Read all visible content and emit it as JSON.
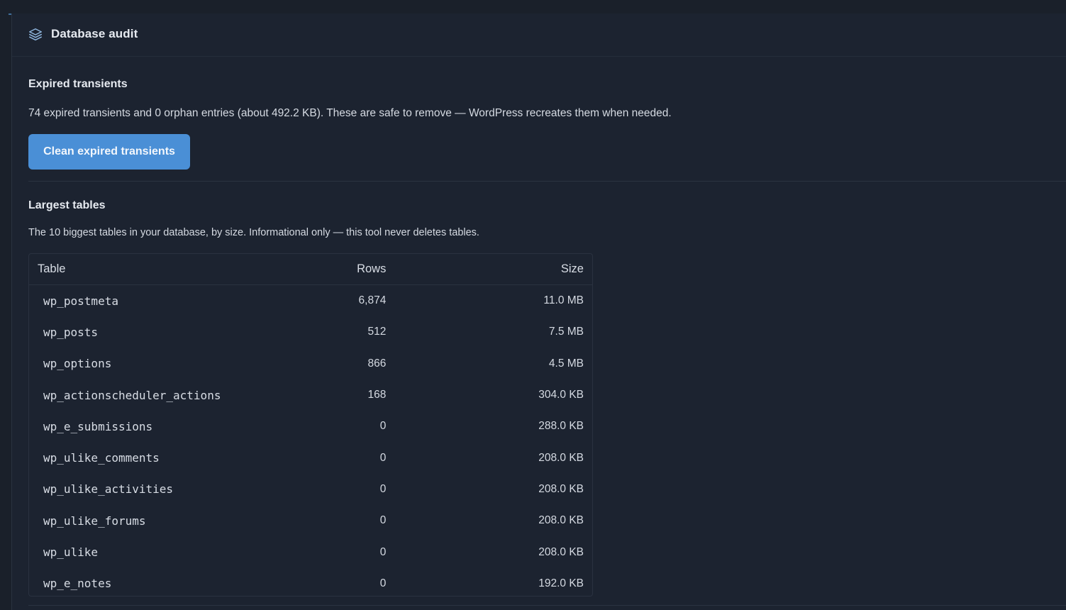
{
  "header": {
    "title": "Database audit",
    "icon": "layers-icon"
  },
  "transients": {
    "title": "Expired transients",
    "description": "74 expired transients and 0 orphan entries (about 492.2 KB). These are safe to remove — WordPress recreates them when needed.",
    "button_label": "Clean expired transients"
  },
  "largest_tables": {
    "title": "Largest tables",
    "description": "The 10 biggest tables in your database, by size. Informational only — this tool never deletes tables.",
    "columns": [
      "Table",
      "Rows",
      "Size"
    ],
    "rows": [
      {
        "table": "wp_postmeta",
        "rows": "6,874",
        "size": "11.0 MB"
      },
      {
        "table": "wp_posts",
        "rows": "512",
        "size": "7.5 MB"
      },
      {
        "table": "wp_options",
        "rows": "866",
        "size": "4.5 MB"
      },
      {
        "table": "wp_actionscheduler_actions",
        "rows": "168",
        "size": "304.0 KB"
      },
      {
        "table": "wp_e_submissions",
        "rows": "0",
        "size": "288.0 KB"
      },
      {
        "table": "wp_ulike_comments",
        "rows": "0",
        "size": "208.0 KB"
      },
      {
        "table": "wp_ulike_activities",
        "rows": "0",
        "size": "208.0 KB"
      },
      {
        "table": "wp_ulike_forums",
        "rows": "0",
        "size": "208.0 KB"
      },
      {
        "table": "wp_ulike",
        "rows": "0",
        "size": "208.0 KB"
      },
      {
        "table": "wp_e_notes",
        "rows": "0",
        "size": "192.0 KB"
      }
    ]
  },
  "colors": {
    "background": "#1a202a",
    "panel": "#1c2330",
    "accent": "#4a8fd6",
    "accent_line": "#3f6f9c"
  }
}
